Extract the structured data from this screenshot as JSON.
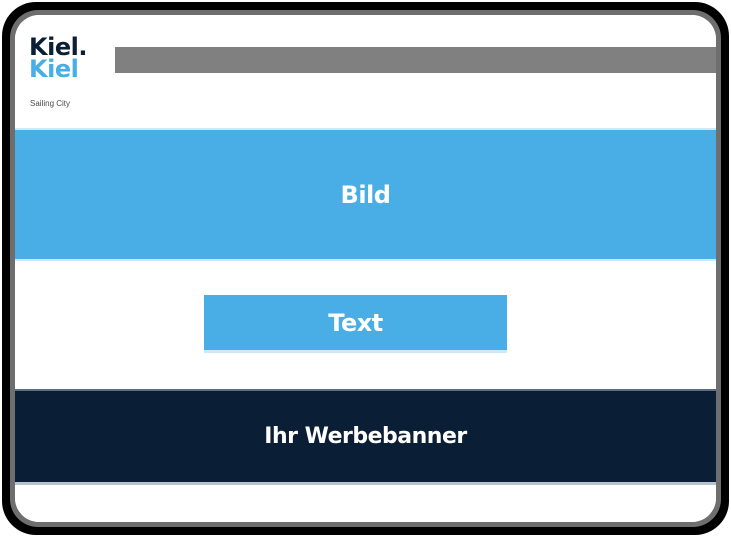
{
  "logo": {
    "line1": "Kiel.",
    "line2": "Kiel",
    "tagline": "Sailing City"
  },
  "sections": {
    "image_placeholder_label": "Bild",
    "text_placeholder_label": "Text",
    "banner_label": "Ihr Werbebanner"
  },
  "colors": {
    "accent_blue": "#4aaee6",
    "navy": "#0a1e35",
    "gray_bar": "#808080",
    "bezel": "#000000"
  }
}
